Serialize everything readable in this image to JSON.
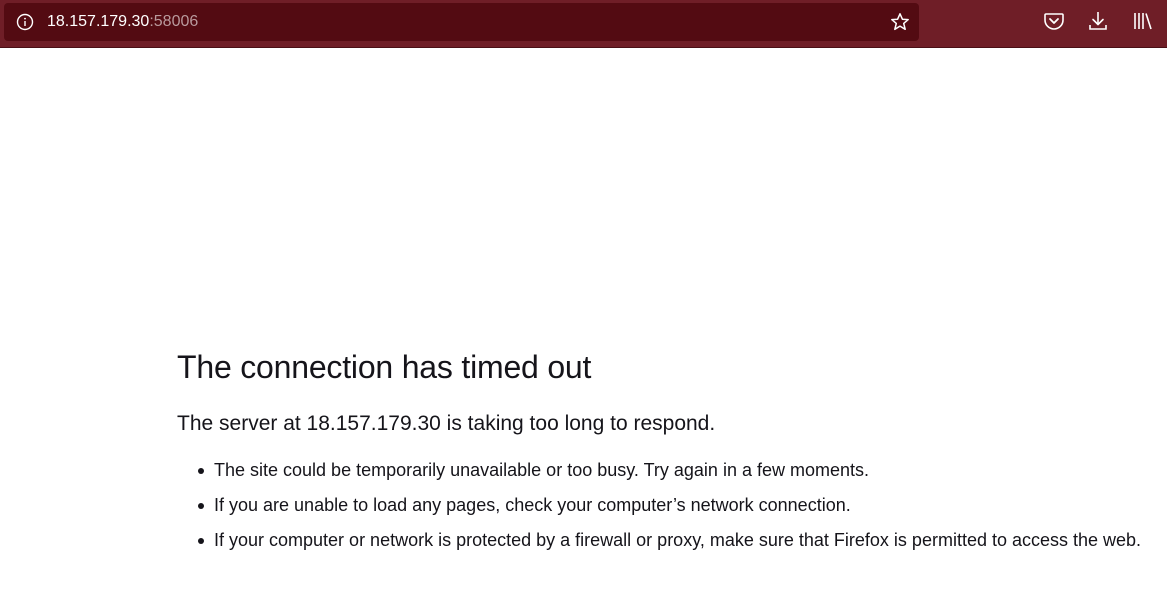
{
  "browser": {
    "url_host": "18.157.179.30",
    "url_port": ":58006",
    "icons": {
      "info": "info-icon",
      "bookmark": "star-icon",
      "pocket": "pocket-icon",
      "downloads": "download-icon",
      "library": "library-icon"
    },
    "colors": {
      "toolbar": "#6f1e27",
      "urlbar": "#530b12"
    }
  },
  "error": {
    "title": "The connection has timed out",
    "subtitle": "The server at 18.157.179.30 is taking too long to respond.",
    "items": [
      "The site could be temporarily unavailable or too busy. Try again in a few moments.",
      "If you are unable to load any pages, check your computer’s network connection.",
      "If your computer or network is protected by a firewall or proxy, make sure that Firefox is permitted to access the web."
    ]
  }
}
